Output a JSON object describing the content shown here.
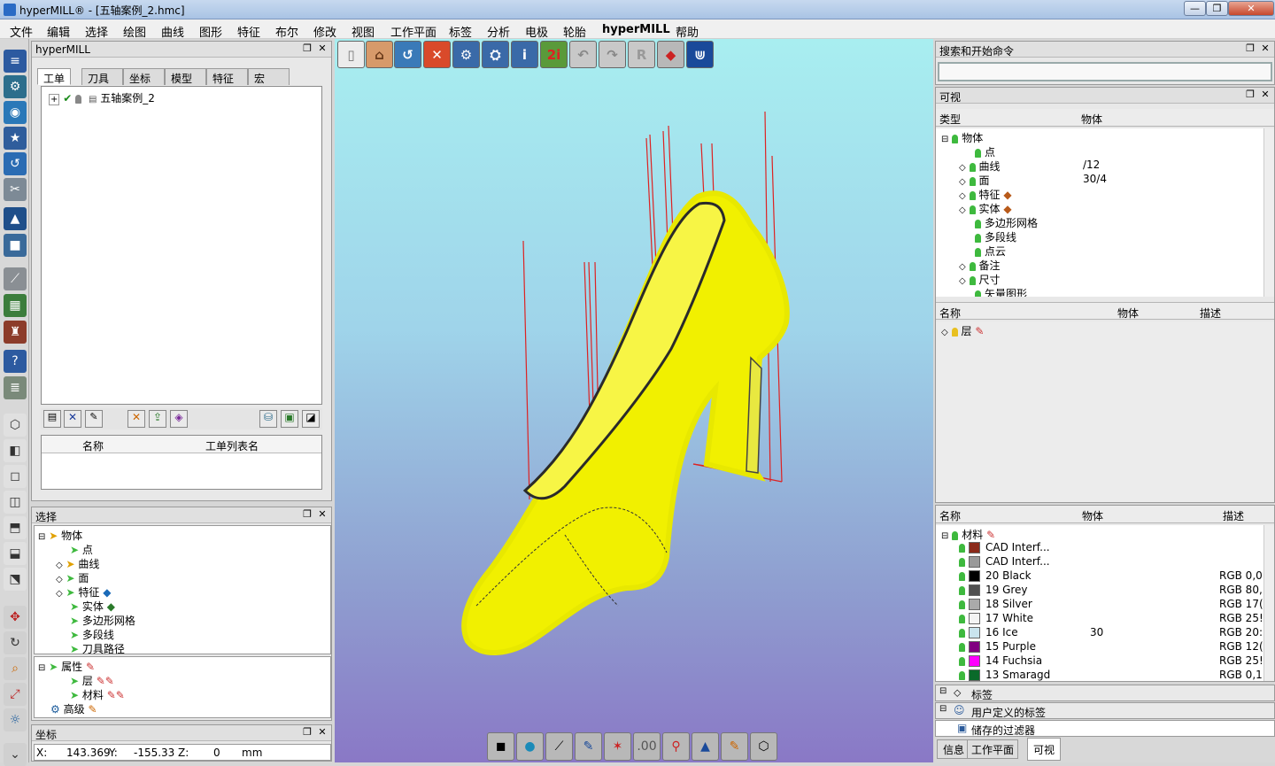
{
  "window": {
    "title": "hyperMILL® - [五轴案例_2.hmc]",
    "min": "—",
    "max": "❐",
    "close": "✕"
  },
  "menu": [
    "文件",
    "编辑",
    "选择",
    "绘图",
    "曲线",
    "图形",
    "特征",
    "布尔",
    "修改",
    "视图",
    "工作平面",
    "标签",
    "分析",
    "电极",
    "轮胎",
    "hyperMILL",
    "帮助"
  ],
  "hm_panel": {
    "title": "hyperMILL",
    "tabs": [
      "工单",
      "刀具",
      "坐标",
      "模型",
      "特征",
      "宏"
    ],
    "tree_item": "五轴案例_2",
    "list_headers": [
      "名称",
      "工单列表名"
    ]
  },
  "select_panel": {
    "title": "选择",
    "root": "物体",
    "items": [
      "点",
      "曲线",
      "面",
      "特征",
      "实体",
      "多边形网格",
      "多段线",
      "刀具路径"
    ],
    "props": "属性",
    "sub": [
      "层",
      "材料"
    ],
    "adv": "高级"
  },
  "coord_panel": {
    "title": "坐标",
    "x_label": "X:",
    "x": "143.369",
    "y_label": "Y:",
    "y": "-155.33",
    "z_label": "Z:",
    "z": "0",
    "unit": "mm"
  },
  "search_panel": {
    "title": "搜索和开始命令"
  },
  "vis_panel": {
    "title": "可视",
    "col1": "类型",
    "col2": "物体",
    "root": "物体",
    "items": [
      {
        "label": "点",
        "val": ""
      },
      {
        "label": "曲线",
        "val": "/12"
      },
      {
        "label": "面",
        "val": "30/4"
      },
      {
        "label": "特征",
        "val": ""
      },
      {
        "label": "实体",
        "val": ""
      },
      {
        "label": "多边形网格",
        "val": ""
      },
      {
        "label": "多段线",
        "val": ""
      },
      {
        "label": "点云",
        "val": ""
      },
      {
        "label": "备注",
        "val": ""
      },
      {
        "label": "尺寸",
        "val": ""
      },
      {
        "label": "矢量图形",
        "val": ""
      }
    ]
  },
  "layer_panel": {
    "col1": "名称",
    "col2": "物体",
    "col3": "描述",
    "item": "层"
  },
  "material_panel": {
    "col1": "名称",
    "col2": "物体",
    "col3": "描述",
    "root": "材料",
    "items": [
      {
        "label": "CAD Interf...",
        "val": "",
        "desc": "",
        "color": "#8b2a1a"
      },
      {
        "label": "CAD Interf...",
        "val": "",
        "desc": "",
        "color": "#9a9a9a"
      },
      {
        "label": "20 Black",
        "val": "",
        "desc": "RGB 0,0",
        "color": "#000000"
      },
      {
        "label": "19 Grey",
        "val": "",
        "desc": "RGB 80,",
        "color": "#505050"
      },
      {
        "label": "18 Silver",
        "val": "",
        "desc": "RGB 17(",
        "color": "#aaaaaa"
      },
      {
        "label": "17 White",
        "val": "",
        "desc": "RGB 25!",
        "color": "#f4f4f4"
      },
      {
        "label": "16 Ice",
        "val": "30",
        "desc": "RGB 20:",
        "color": "#c9e4ee"
      },
      {
        "label": "15 Purple",
        "val": "",
        "desc": "RGB 12(",
        "color": "#800080"
      },
      {
        "label": "14 Fuchsia",
        "val": "",
        "desc": "RGB 25!",
        "color": "#ff00ff"
      },
      {
        "label": "13 Smaragd",
        "val": "",
        "desc": "RGB 0,1",
        "color": "#0a6a2a"
      }
    ]
  },
  "tag_rows": [
    "标签",
    "用户定义的标签",
    "储存的过滤器"
  ],
  "bottom_tabs": [
    "信息",
    "工作平面",
    "可视"
  ]
}
